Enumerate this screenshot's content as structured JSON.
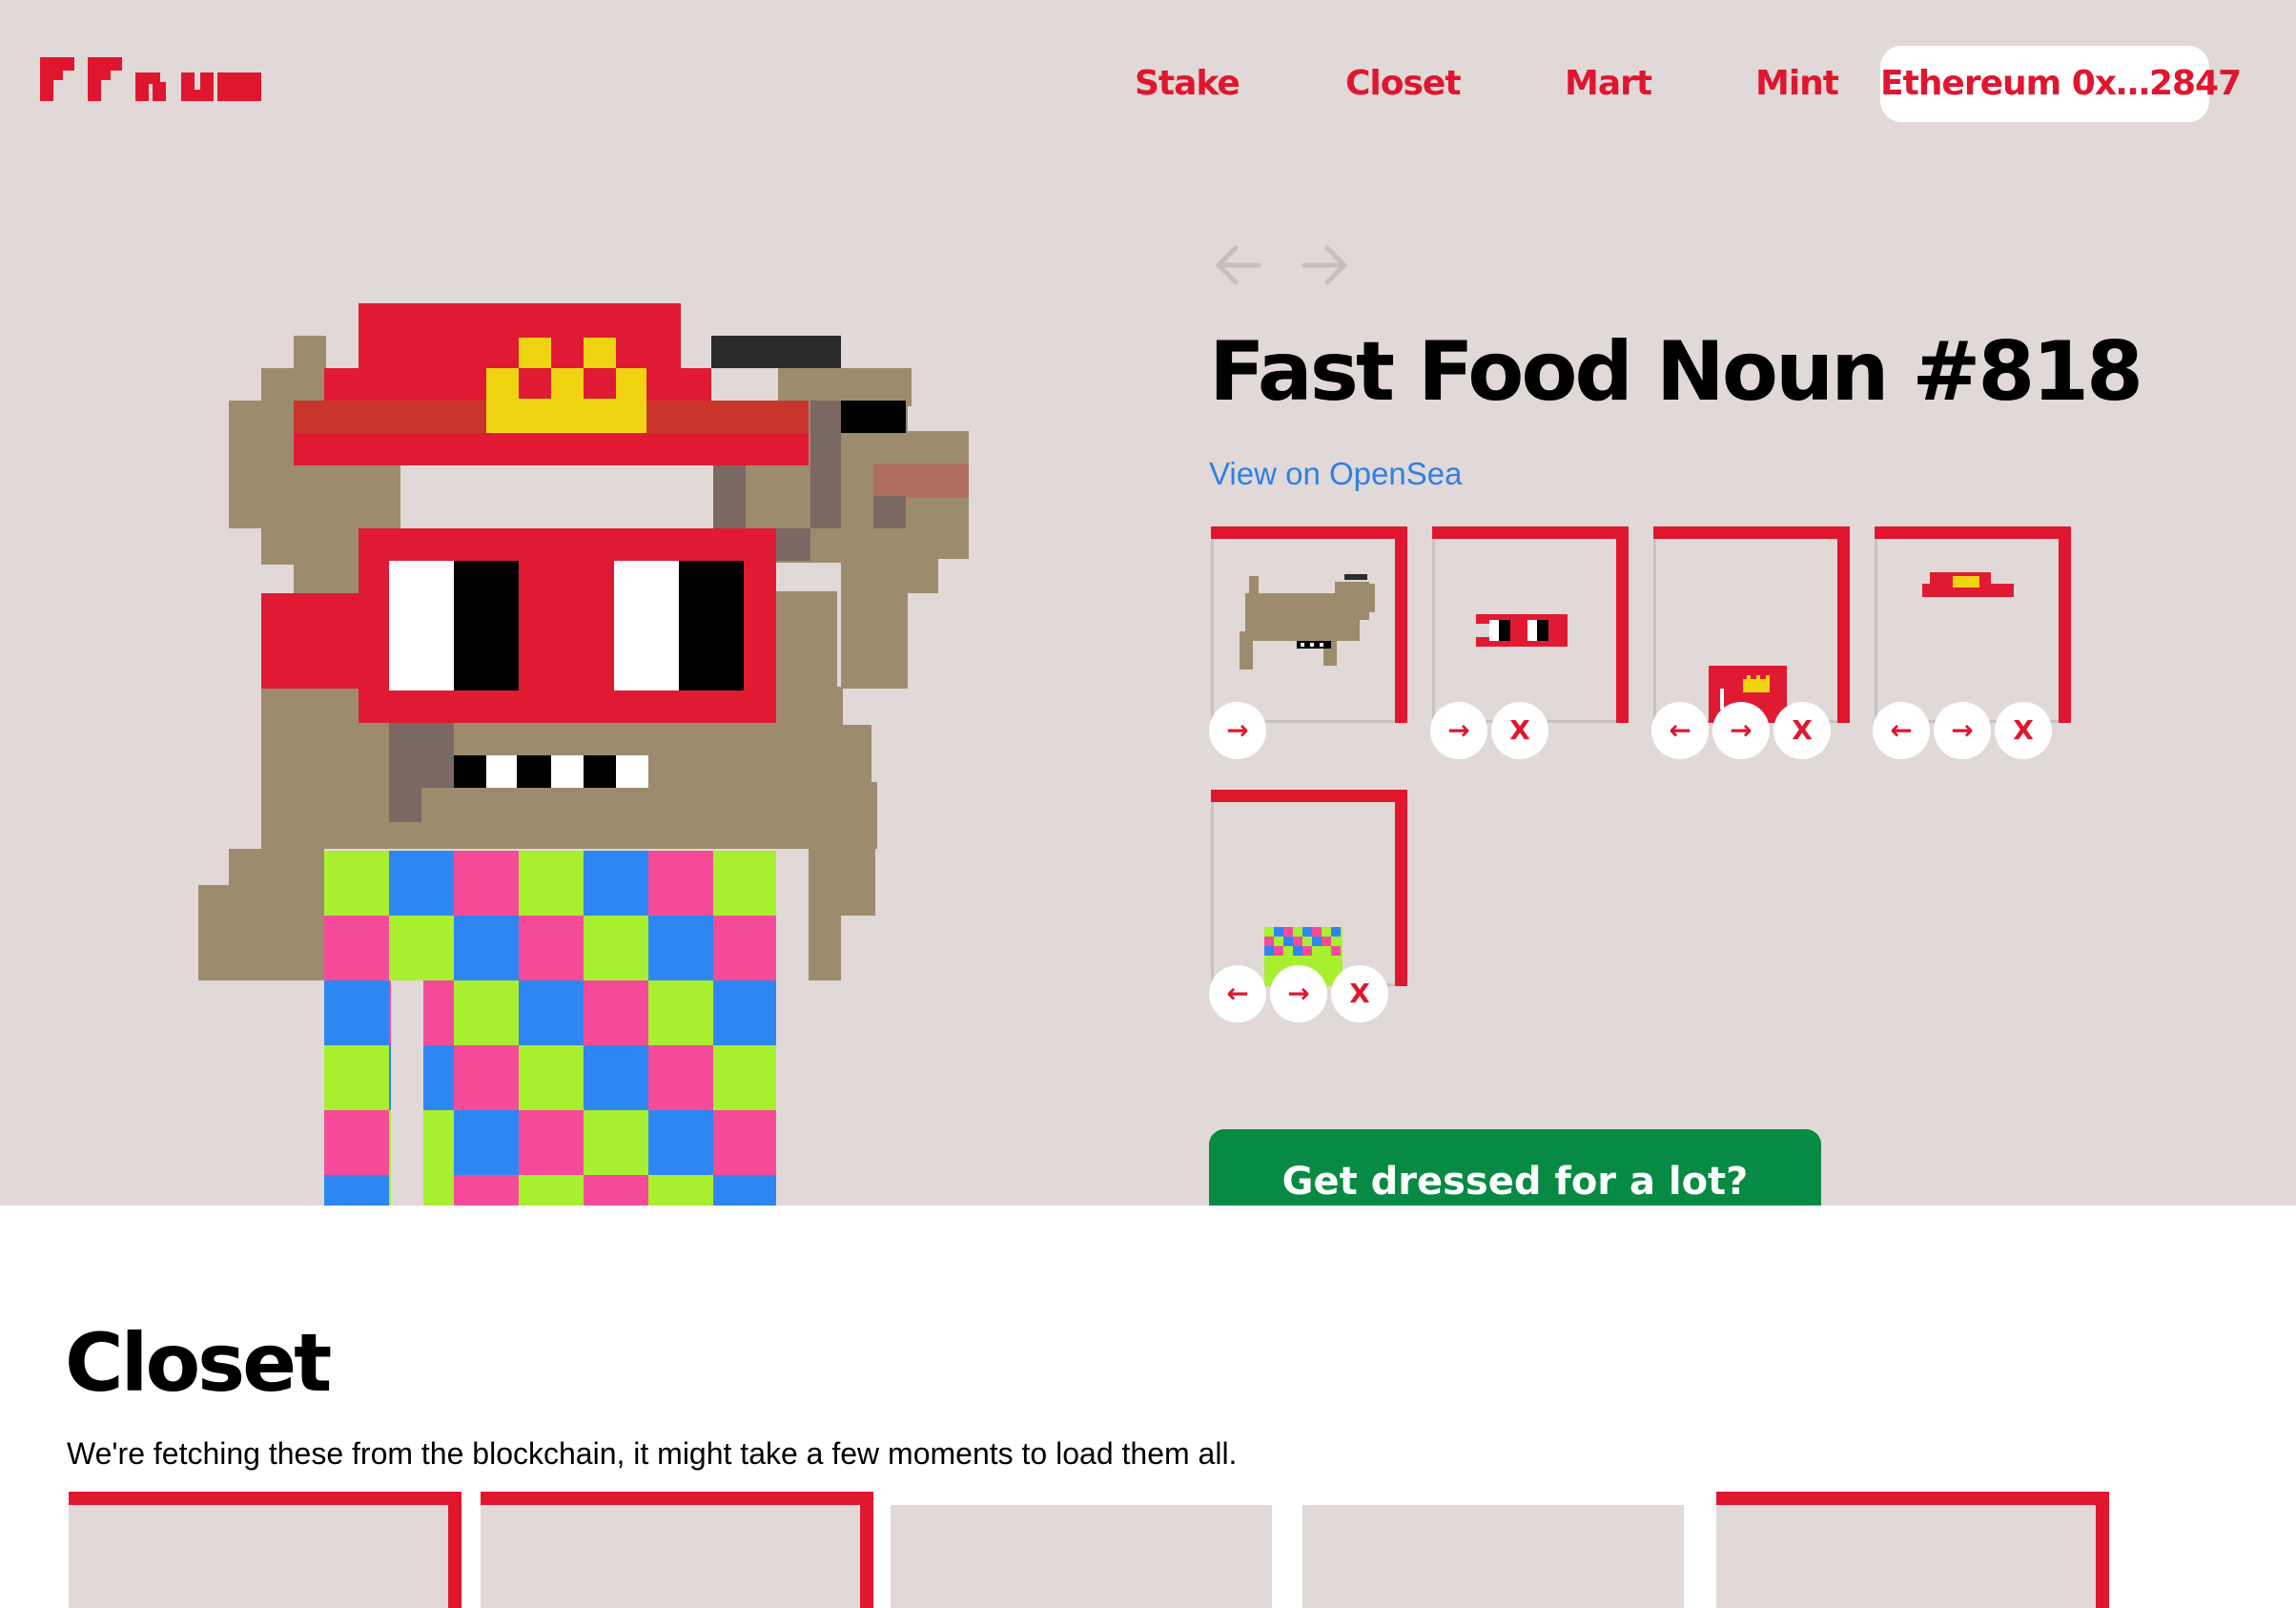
{
  "nav": {
    "items": [
      "Stake",
      "Closet",
      "Mart",
      "Mint"
    ],
    "wallet": "Ethereum 0x…2847"
  },
  "brand": {
    "accent": "#e0162f",
    "background": "#e1d9d7",
    "cta_color": "#078a44",
    "link_color": "#2f7fe6"
  },
  "icons": {
    "prev": "arrow-left-icon",
    "next": "arrow-right-icon"
  },
  "noun": {
    "title": "Fast Food Noun #818",
    "opensea_label": "View on OpenSea"
  },
  "traits": [
    {
      "name": "body",
      "buttons": [
        "→"
      ]
    },
    {
      "name": "glasses",
      "buttons": [
        "→",
        "X"
      ]
    },
    {
      "name": "accessory",
      "buttons": [
        "←",
        "→",
        "X"
      ]
    },
    {
      "name": "hat",
      "buttons": [
        "←",
        "→",
        "X"
      ]
    },
    {
      "name": "pants",
      "buttons": [
        "←",
        "→",
        "X"
      ]
    }
  ],
  "cta": {
    "label": "Get dressed for a lot?"
  },
  "closet": {
    "title": "Closet",
    "description": "We're fetching these from the blockchain, it might take a few moments to load them all."
  }
}
